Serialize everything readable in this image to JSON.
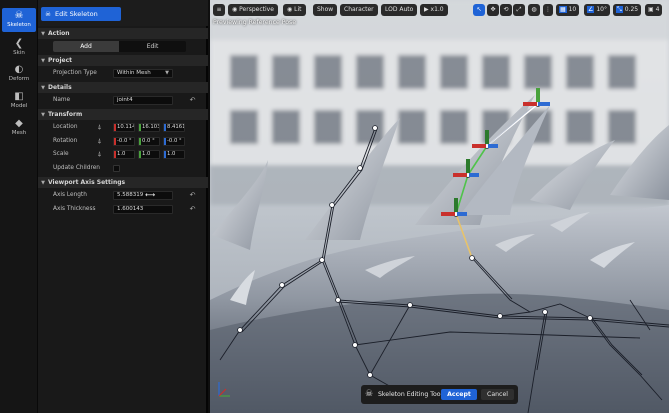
{
  "toolbar": {
    "items": [
      {
        "label": "Skeleton",
        "icon": "skeleton-icon",
        "active": true
      },
      {
        "label": "Skin",
        "icon": "skin-icon",
        "active": false
      },
      {
        "label": "Deform",
        "icon": "deform-icon",
        "active": false
      },
      {
        "label": "Model",
        "icon": "model-icon",
        "active": false
      },
      {
        "label": "Mesh",
        "icon": "mesh-icon",
        "active": false
      }
    ]
  },
  "panel": {
    "header_button": "Edit Skeleton",
    "sections": {
      "action": "Action",
      "project": "Project",
      "details": "Details",
      "transform": "Transform",
      "viewport_axis": "Viewport Axis Settings"
    },
    "action": {
      "add": "Add",
      "edit": "Edit"
    },
    "project": {
      "projection_type_label": "Projection Type",
      "projection_type_value": "Within Mesh"
    },
    "details": {
      "name_label": "Name",
      "name_value": "joint4"
    },
    "transform": {
      "location_label": "Location",
      "location": [
        "10.114",
        "16.103",
        "8.4161"
      ],
      "rotation_label": "Rotation",
      "rotation": [
        "-0.0 °",
        "0.0 °",
        "-0.0 °"
      ],
      "scale_label": "Scale",
      "scale": [
        "1.0",
        "1.0",
        "1.0"
      ],
      "update_children_label": "Update Children",
      "update_children": false
    },
    "viewport_axis": {
      "axis_length_label": "Axis Length",
      "axis_length_value": "5.588319",
      "axis_thickness_label": "Axis Thickness",
      "axis_thickness_value": "1.600143"
    }
  },
  "viewport": {
    "toolbar": {
      "menu": "≡",
      "perspective": "Perspective",
      "lit": "Lit",
      "show": "Show",
      "character": "Character",
      "lod": "LOD Auto",
      "play_speed": "x1.0",
      "grid_size": "10",
      "rotation_snap": "10°",
      "scale_snap": "0.25",
      "camera_speed": "4"
    },
    "preview_label": "Previewing Reference Pose",
    "colors": {
      "accent": "#1f63d6",
      "axis_x": "#c9302c",
      "axis_y": "#49a23c",
      "axis_z": "#2d6bd3",
      "bone_selected": "#e8c36a"
    }
  },
  "bottom_bar": {
    "tool_name": "Skeleton Editing Tool",
    "accept": "Accept",
    "cancel": "Cancel"
  }
}
